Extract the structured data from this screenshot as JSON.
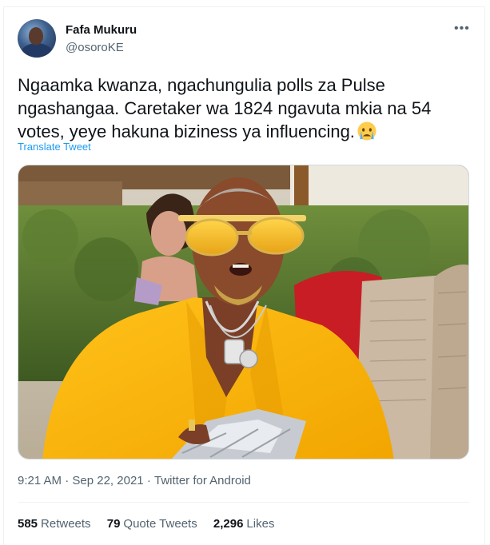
{
  "author": {
    "name": "Fafa Mukuru",
    "handle": "@osoroKE"
  },
  "more_label": "•••",
  "tweet": {
    "text": "Ngaamka kwanza, ngachungulia polls za Pulse ngashangaa. Caretaker wa 1824 ngavuta mkia na 54 votes, yeye hakuna biziness ya influencing.",
    "emoji": "crying-face-emoji"
  },
  "translate_label": "Translate Tweet",
  "meta": {
    "time": "9:21 AM",
    "separator": "·",
    "date": "Sep 22, 2021",
    "source": "Twitter for Android"
  },
  "stats": {
    "retweets_count": "585",
    "retweets_label": "Retweets",
    "quote_count": "79",
    "quote_label": "Quote Tweets",
    "likes_count": "2,296",
    "likes_label": "Likes"
  },
  "colors": {
    "link": "#1d9bf0",
    "secondary_text": "#536471",
    "primary_text": "#0f1419"
  }
}
